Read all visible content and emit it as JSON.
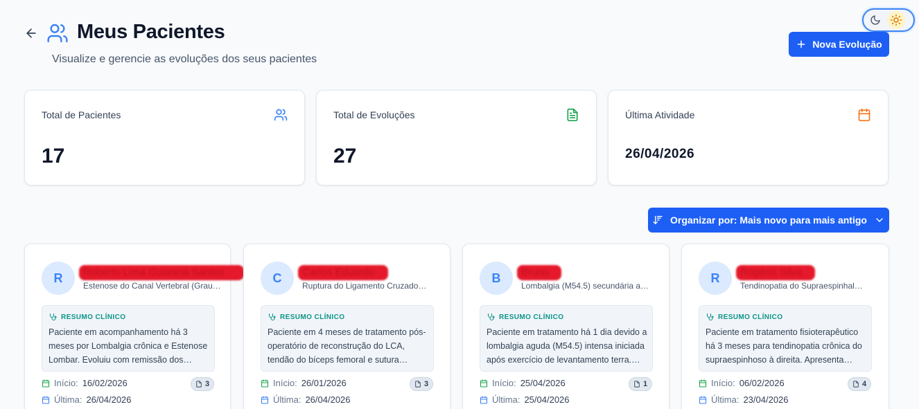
{
  "header": {
    "title": "Meus Pacientes",
    "subtitle": "Visualize e gerencie as evoluções dos seus pacientes",
    "new_button_label": "Nova Evolução"
  },
  "theme_toggle": {
    "options": [
      "moon-icon",
      "sun-icon"
    ],
    "active": "sun-icon"
  },
  "stats": [
    {
      "label": "Total de Pacientes",
      "value": "17",
      "icon": "users-icon",
      "color": "#3b82f6"
    },
    {
      "label": "Total de Evoluções",
      "value": "27",
      "icon": "file-text-icon",
      "color": "#16a34a"
    },
    {
      "label": "Última Atividade",
      "value": "26/04/2026",
      "icon": "calendar-icon",
      "color": "#f97316"
    }
  ],
  "sort": {
    "label": "Organizar por: Mais novo para mais antigo"
  },
  "summary_heading": "RESUMO CLÍNICO",
  "labels": {
    "start": "Início:",
    "last": "Última:"
  },
  "patients": [
    {
      "initial": "R",
      "name": "Roberto Lima Guaraná Santos",
      "diagnosis": "Estenose do Canal Vertebral (Grau I-II)",
      "summary": "Paciente em acompanhamento há 3 meses por Lombalgia crônica e Estenose Lombar. Evoluiu com remissão dos…",
      "start": "16/02/2026",
      "last": "26/04/2026",
      "count": "3"
    },
    {
      "initial": "C",
      "name": "Carlos Eduardo",
      "diagnosis": "Ruptura do Ligamento Cruzado…",
      "summary": "Paciente em 4 meses de tratamento pós-operatório de reconstrução do LCA, tendão do bíceps femoral e sutura…",
      "start": "26/01/2026",
      "last": "26/04/2026",
      "count": "3"
    },
    {
      "initial": "B",
      "name": "Bruno",
      "diagnosis": "Lombalgia (M54.5) secundária a…",
      "summary": "Paciente em tratamento há 1 dia devido a lombalgia aguda (M54.5) intensa iniciada após exercício de levantamento terra. A…",
      "start": "25/04/2026",
      "last": "25/04/2026",
      "count": "1"
    },
    {
      "initial": "R",
      "name": "Rogério Silva",
      "diagnosis": "Tendinopatia do Supraespinhal…",
      "summary": "Paciente em tratamento fisioterapêutico há 3 meses para tendinopatia crônica do supraespinhoso à direita. Apresenta…",
      "start": "06/02/2026",
      "last": "23/04/2026",
      "count": "4"
    }
  ]
}
